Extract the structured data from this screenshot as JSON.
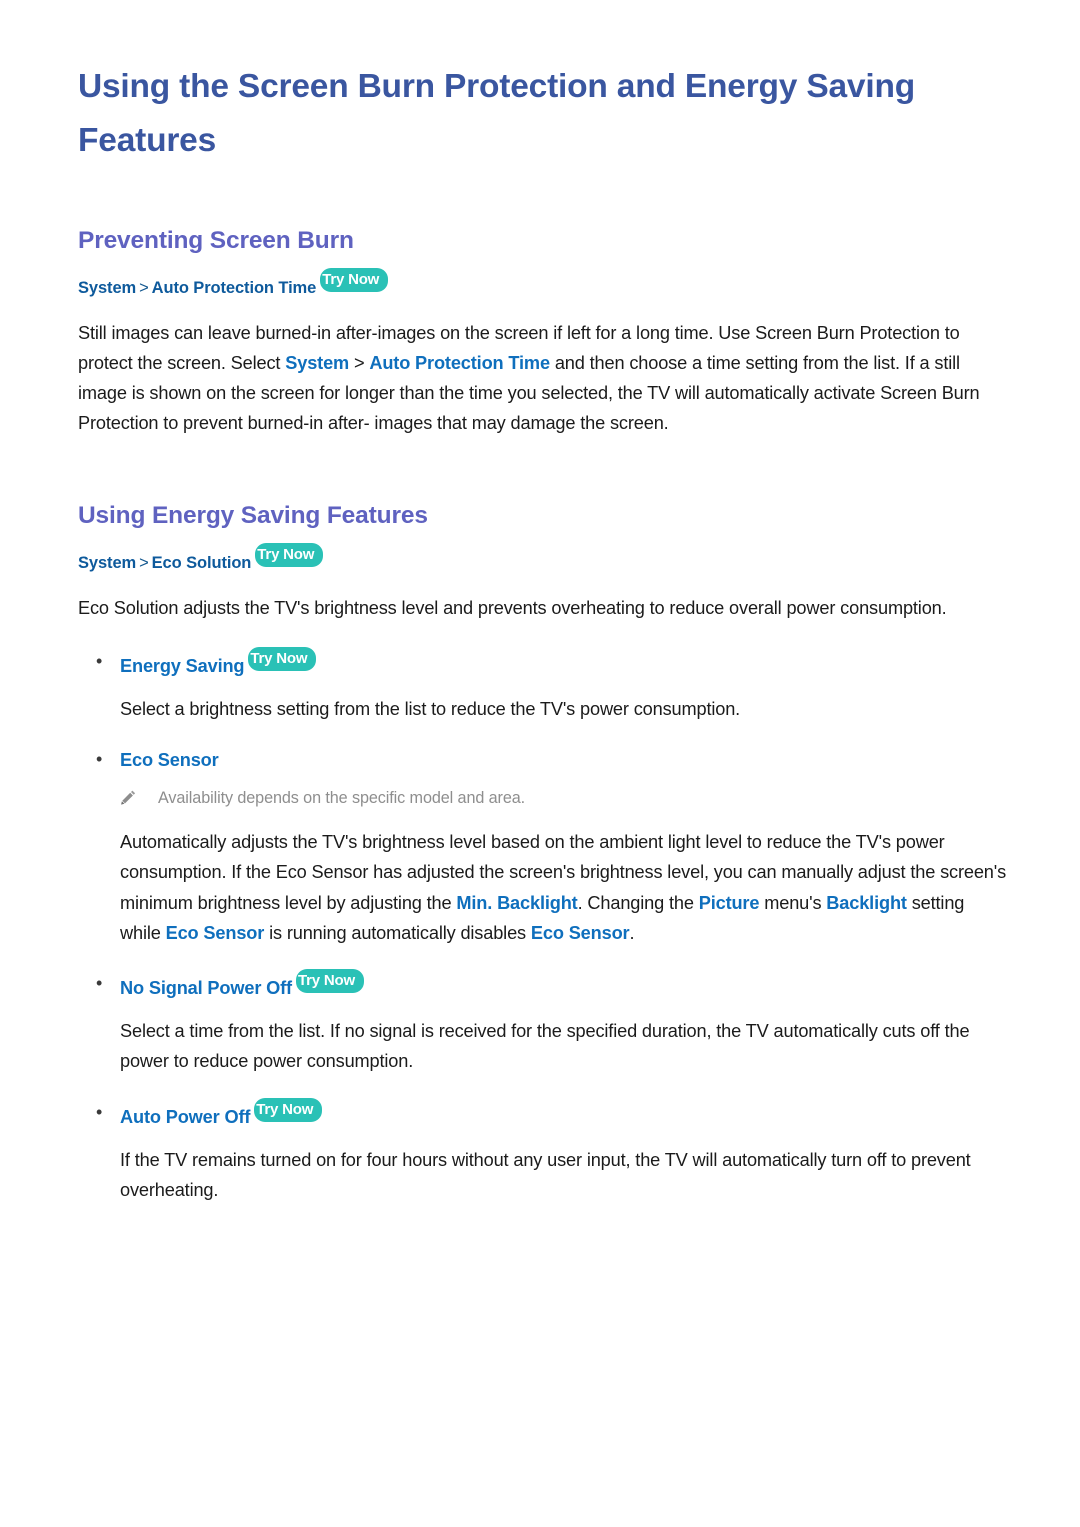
{
  "document": {
    "title": "Using the Screen Burn Protection and Energy Saving Features"
  },
  "colors": {
    "title": "#3a56a0",
    "section_heading": "#5f62c0",
    "breadcrumb": "#0e5a9c",
    "inline_emphasis": "#0f6fbd",
    "badge_background": "#2ac1b6",
    "badge_text": "#ffffff",
    "body_text": "#1b1b1b",
    "note_text": "#8e8e8e",
    "page_background": "#ffffff"
  },
  "badge": {
    "try_now_label": "Try Now"
  },
  "sections": [
    {
      "heading": "Preventing Screen Burn",
      "breadcrumb": {
        "root": "System",
        "separator": ">",
        "leaf": "Auto Protection Time",
        "has_try_now": true
      },
      "paragraph": {
        "part1": "Still images can leave burned-in after-images on the screen if left for a long time. Use Screen Burn Protection to protect the screen. Select ",
        "em1": "System",
        "sep": " > ",
        "em2": "Auto Protection Time",
        "part2": " and then choose a time setting from the list. If a still image is shown on the screen for longer than the time you selected, the TV will automatically activate Screen Burn Protection to prevent burned-in after- images that may damage the screen."
      }
    },
    {
      "heading": "Using Energy Saving Features",
      "breadcrumb": {
        "root": "System",
        "separator": ">",
        "leaf": "Eco Solution",
        "has_try_now": true
      },
      "intro": "Eco Solution adjusts the TV's brightness level and prevents overheating to reduce overall power consumption."
    }
  ],
  "bullets": [
    {
      "label": "Energy Saving",
      "has_try_now": true,
      "body": "Select a brightness setting from the list to reduce the TV's power consumption."
    },
    {
      "label": "Eco Sensor",
      "has_try_now": false,
      "note_icon": "pencil-icon",
      "note": "Availability depends on the specific model and area.",
      "body_parts": {
        "p1": "Automatically adjusts the TV's brightness level based on the ambient light level to reduce the TV's power consumption. If the Eco Sensor has adjusted the screen's brightness level, you can manually adjust the screen's minimum brightness level by adjusting the ",
        "e1": "Min. Backlight",
        "p2": ". Changing the ",
        "e2": "Picture",
        "p3": " menu's ",
        "e3": "Backlight",
        "p4": " setting while ",
        "e4": "Eco Sensor",
        "p5": " is running automatically disables ",
        "e5": "Eco Sensor",
        "p6": "."
      }
    },
    {
      "label": "No Signal Power Off",
      "has_try_now": true,
      "body": "Select a time from the list. If no signal is received for the specified duration, the TV automatically cuts off the power to reduce power consumption."
    },
    {
      "label": "Auto Power Off",
      "has_try_now": true,
      "body": "If the TV remains turned on for four hours without any user input, the TV will automatically turn off to prevent overheating."
    }
  ]
}
